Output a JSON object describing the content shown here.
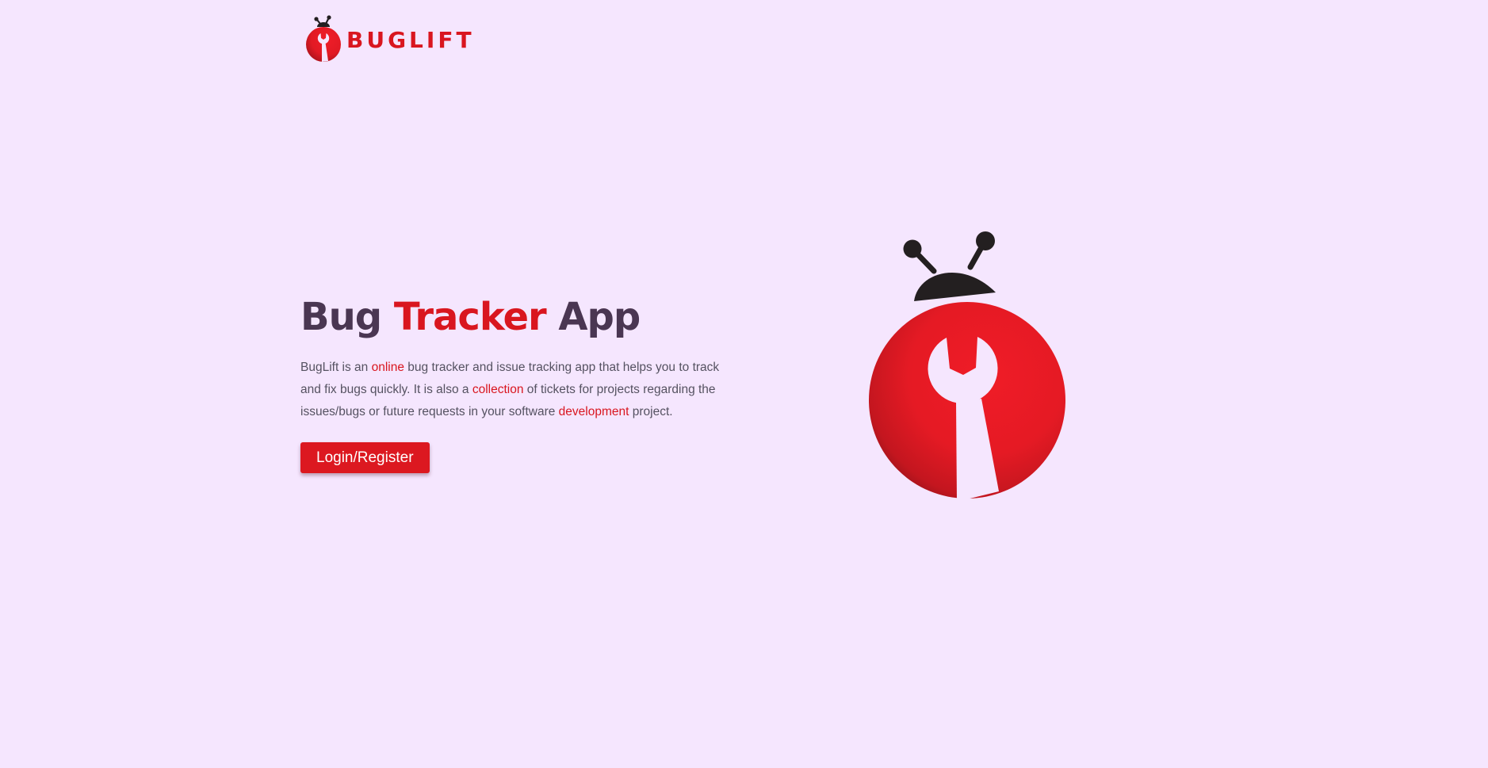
{
  "header": {
    "logo_text": "BUGLIFT"
  },
  "hero": {
    "title_part1": "Bug",
    "title_accent": "Tracker",
    "title_part2": "App",
    "description": {
      "seg1": "BugLift is an ",
      "link1": "online",
      "seg2": " bug tracker and issue tracking app that helps you to track and fix bugs quickly. It is also a ",
      "link2": "collection",
      "seg3": " of tickets for projects regarding the issues/bugs or future requests in your software ",
      "link3": "development",
      "seg4": " project."
    },
    "cta_label": "Login/Register"
  },
  "icons": {
    "logo": "ladybug-wrench-icon",
    "illustration": "ladybug-wrench-icon"
  },
  "colors": {
    "background": "#f5e6fe",
    "accent": "#d9161f",
    "heading": "#4a3652",
    "body_text": "#555261",
    "button_bg": "#dc1820"
  }
}
